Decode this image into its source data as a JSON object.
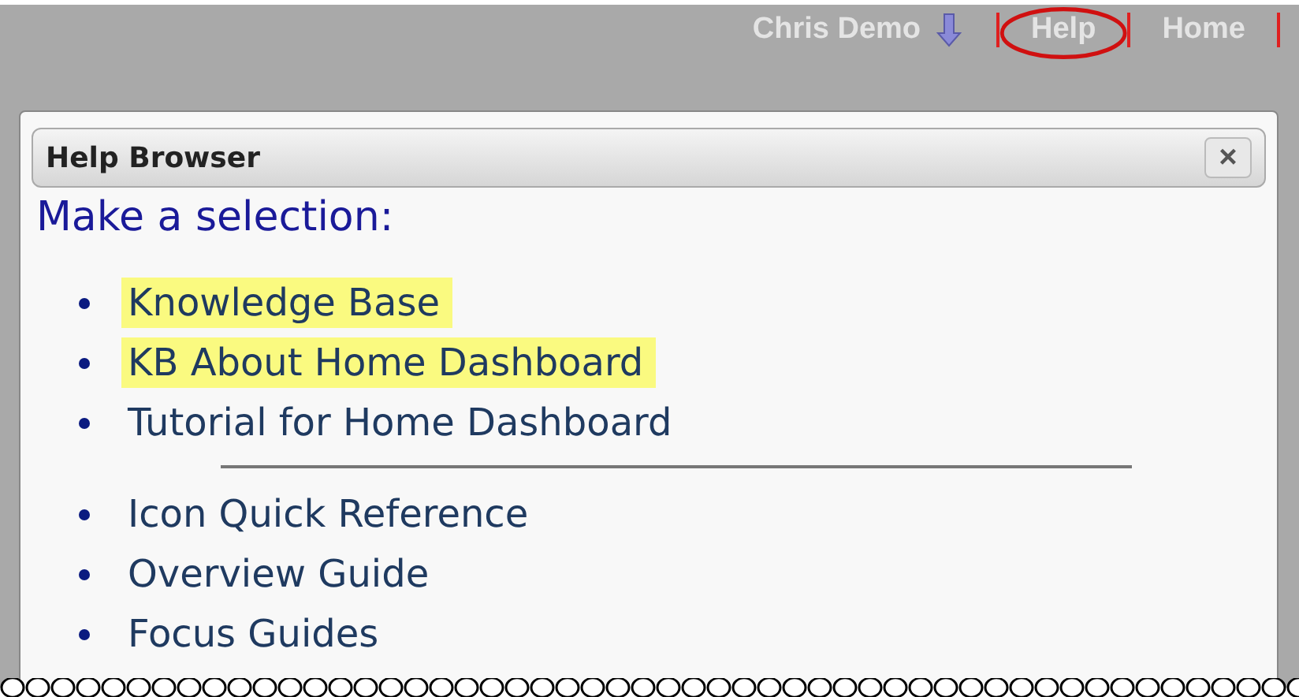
{
  "top_bar": {
    "user": "Chris Demo",
    "links": [
      {
        "label": "Help",
        "circled": true
      },
      {
        "label": "Home",
        "circled": false
      }
    ]
  },
  "dialog": {
    "title": "Help Browser",
    "close": "×",
    "heading": "Make a selection:",
    "groups": [
      [
        {
          "label": "Knowledge Base",
          "highlighted": true
        },
        {
          "label": "KB About Home Dashboard",
          "highlighted": true
        },
        {
          "label": "Tutorial for Home Dashboard",
          "highlighted": false
        }
      ],
      [
        {
          "label": "Icon Quick Reference",
          "highlighted": false
        },
        {
          "label": "Overview Guide",
          "highlighted": false
        },
        {
          "label": "Focus Guides",
          "highlighted": false
        }
      ]
    ]
  }
}
